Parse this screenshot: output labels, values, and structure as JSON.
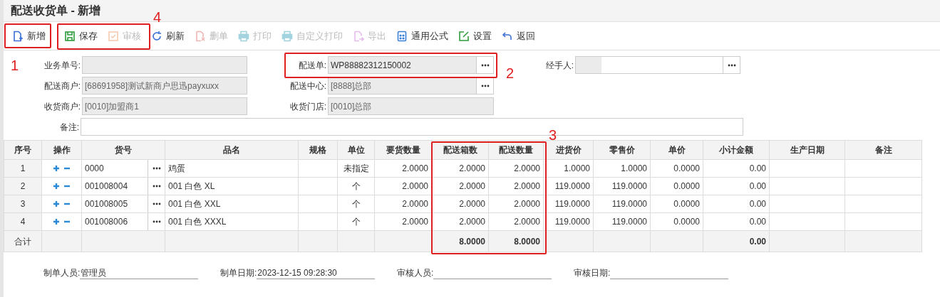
{
  "window": {
    "title": "配送收货单 - 新增"
  },
  "toolbar": [
    {
      "kind": "new",
      "label": "新增",
      "disabled": false
    },
    {
      "kind": "save",
      "label": "保存",
      "disabled": false
    },
    {
      "kind": "audit",
      "label": "审核",
      "disabled": true
    },
    {
      "kind": "refresh",
      "label": "刷新",
      "disabled": false
    },
    {
      "kind": "delete",
      "label": "删单",
      "disabled": true
    },
    {
      "kind": "print",
      "label": "打印",
      "disabled": true
    },
    {
      "kind": "print",
      "label": "自定义打印",
      "disabled": true
    },
    {
      "kind": "export",
      "label": "导出",
      "disabled": true
    },
    {
      "kind": "formula",
      "label": "通用公式",
      "disabled": false
    },
    {
      "kind": "settings",
      "label": "设置",
      "disabled": false
    },
    {
      "kind": "back",
      "label": "返回",
      "disabled": false
    }
  ],
  "form": {
    "rows": [
      [
        {
          "label": "业务单号:",
          "picker": false
        },
        {
          "label": "配送单:",
          "value": "WP88882312150002",
          "picker": true,
          "editable": true
        },
        {
          "label": "经手人:",
          "picker": true,
          "editable": true
        }
      ],
      [
        {
          "label": "配送商户:",
          "value": "[68691958]测试新商户思迅payxuxx",
          "picker": false
        },
        {
          "label": "配送中心:",
          "value": "[8888]总部",
          "picker": true,
          "editable": false
        }
      ],
      [
        {
          "label": "收货商户:",
          "value": "[0010]加盟商1",
          "picker": false
        },
        {
          "label": "收货门店:",
          "value": "[0010]总部",
          "picker": false
        }
      ]
    ],
    "remark": {
      "label": "备注:"
    }
  },
  "table": {
    "columns": [
      "序号",
      "操作",
      "货号",
      "品名",
      "规格",
      "单位",
      "要货数量",
      "配送箱数",
      "配送数量",
      "进货价",
      "零售价",
      "单价",
      "小计金额",
      "生产日期",
      "备注"
    ],
    "rows": [
      {
        "seq": "1",
        "code": "0000",
        "name": "鸡蛋",
        "unit": "未指定",
        "req_qty": "2.0000",
        "boxes": "2.0000",
        "qty": "2.0000",
        "purchase_price": "1.0000",
        "retail_price": "1.0000",
        "unit_price": "0.0000",
        "subtotal": "0.00"
      },
      {
        "seq": "2",
        "code": "001008004",
        "name": "001 白色 XL",
        "unit": "个",
        "req_qty": "2.0000",
        "boxes": "2.0000",
        "qty": "2.0000",
        "purchase_price": "119.0000",
        "retail_price": "119.0000",
        "unit_price": "0.0000",
        "subtotal": "0.00"
      },
      {
        "seq": "3",
        "code": "001008005",
        "name": "001 白色 XXL",
        "unit": "个",
        "req_qty": "2.0000",
        "boxes": "2.0000",
        "qty": "2.0000",
        "purchase_price": "119.0000",
        "retail_price": "119.0000",
        "unit_price": "0.0000",
        "subtotal": "0.00"
      },
      {
        "seq": "4",
        "code": "001008006",
        "name": "001 白色 XXXL",
        "unit": "个",
        "req_qty": "2.0000",
        "boxes": "2.0000",
        "qty": "2.0000",
        "purchase_price": "119.0000",
        "retail_price": "119.0000",
        "unit_price": "0.0000",
        "subtotal": "0.00"
      }
    ],
    "totals": {
      "label": "合计",
      "boxes": "8.0000",
      "qty": "8.0000",
      "subtotal": "0.00"
    }
  },
  "footer": [
    {
      "label": "制单人员:",
      "value": "管理员"
    },
    {
      "label": "制单日期:",
      "value": "2023-12-15 09:28:30"
    },
    {
      "label": "审核人员:"
    },
    {
      "label": "审核日期:"
    }
  ],
  "annotations": [
    {
      "label": "1"
    },
    {
      "label": "2"
    },
    {
      "label": "3"
    },
    {
      "label": "4"
    }
  ]
}
